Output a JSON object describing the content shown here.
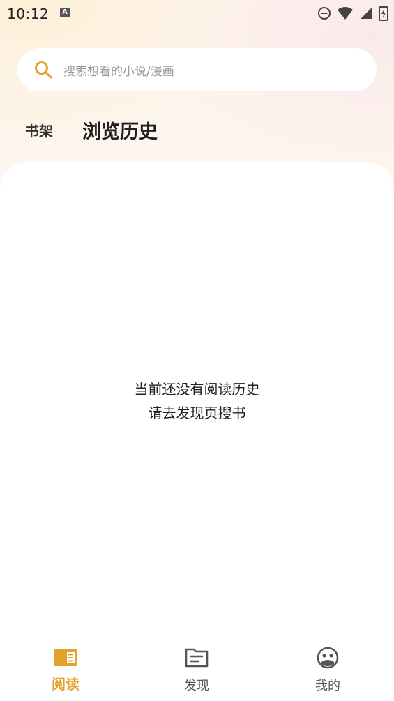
{
  "status_bar": {
    "time": "10:12",
    "notification_badge": "A"
  },
  "search": {
    "placeholder": "搜索想看的小说/漫画"
  },
  "tabs": {
    "shelf_label": "书架",
    "history_label": "浏览历史",
    "active": "history"
  },
  "empty_state": {
    "line1": "当前还没有阅读历史",
    "line2": "请去发现页搜书"
  },
  "bottom_nav": {
    "items": [
      {
        "label": "阅读",
        "icon": "book-icon",
        "active": true
      },
      {
        "label": "发现",
        "icon": "discover-icon",
        "active": false
      },
      {
        "label": "我的",
        "icon": "profile-icon",
        "active": false
      }
    ]
  },
  "colors": {
    "accent": "#e5a12e",
    "inactive": "#555555",
    "background_tint": "#fdf6ee"
  }
}
